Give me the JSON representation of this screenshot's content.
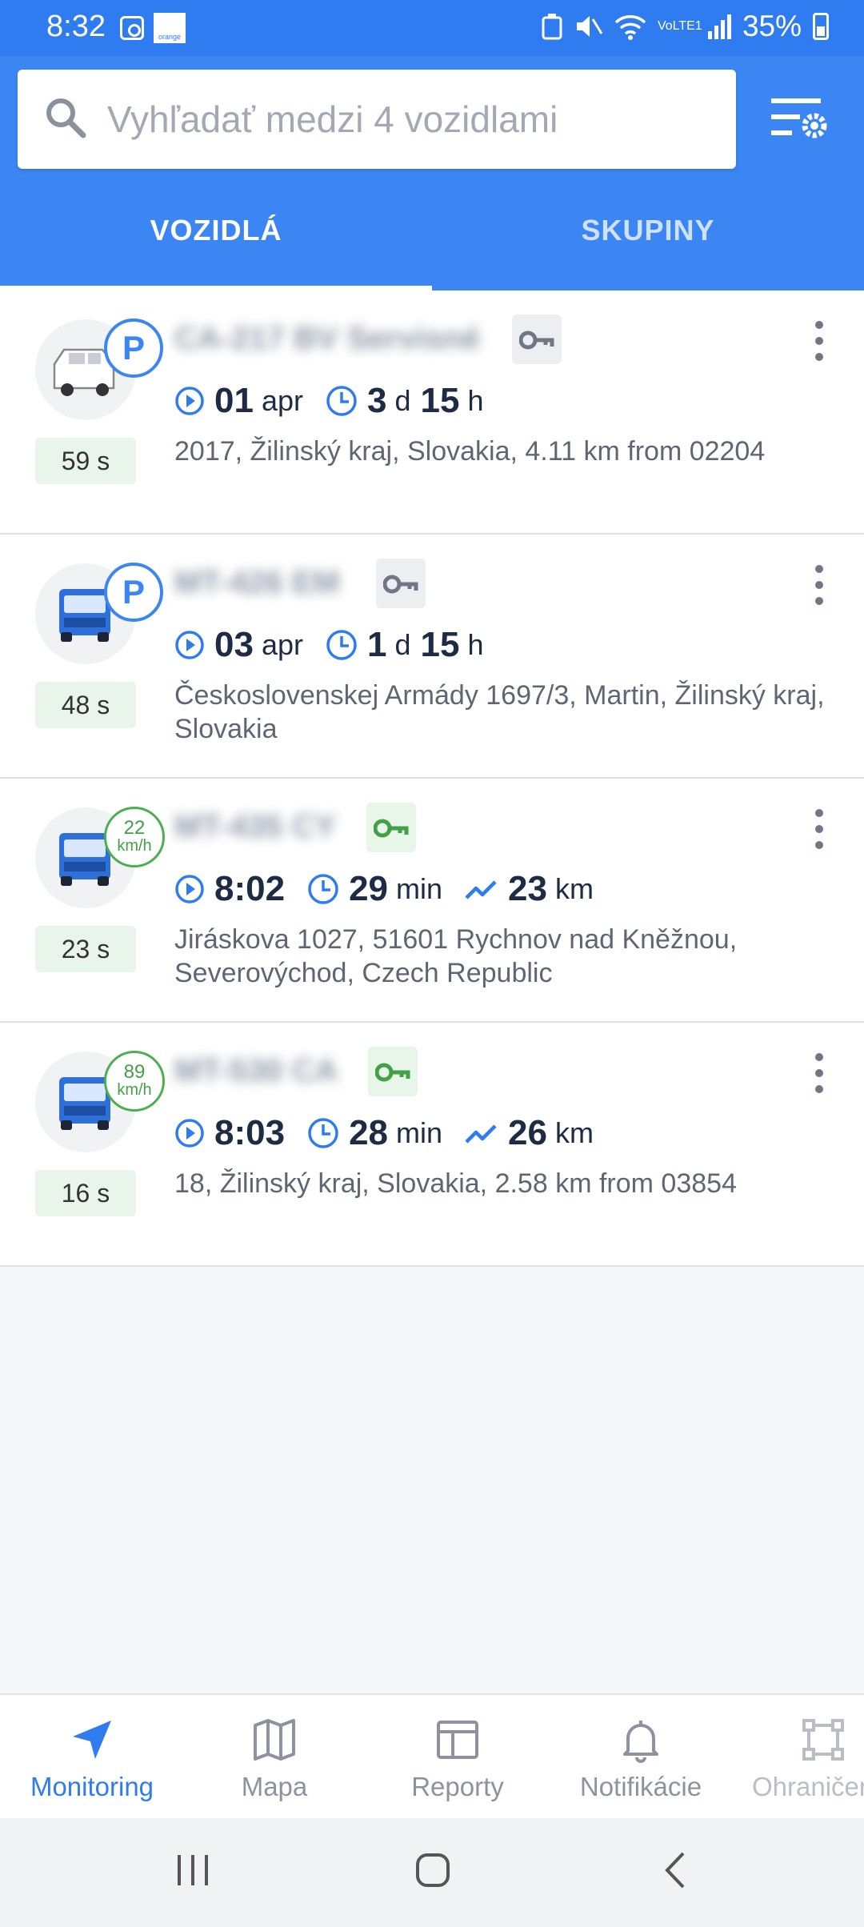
{
  "status_bar": {
    "time": "8:32",
    "carrier_logo": "orange",
    "network": "VoLTE1",
    "battery": "35%"
  },
  "search": {
    "placeholder": "Vyhľadať medzi 4 vozidlami",
    "value": ""
  },
  "tabs": [
    {
      "label": "VOZIDLÁ",
      "active": true
    },
    {
      "label": "SKUPINY",
      "active": false
    }
  ],
  "vehicles": [
    {
      "plate": "CA-217 BV Servisné",
      "icon": "van-icon",
      "state": "P",
      "last_update": "59 s",
      "ignition": "off",
      "start_value": "01",
      "start_unit": "apr",
      "duration_days": "3",
      "duration_days_unit": "d",
      "duration_hours": "15",
      "duration_hours_unit": "h",
      "address": "2017, Žilinský kraj, Slovakia, 4.11 km from 02204"
    },
    {
      "plate": "MT-426 EM",
      "icon": "truck-icon",
      "state": "P",
      "last_update": "48 s",
      "ignition": "off",
      "start_value": "03",
      "start_unit": "apr",
      "duration_days": "1",
      "duration_days_unit": "d",
      "duration_hours": "15",
      "duration_hours_unit": "h",
      "address": "Československej Armády 1697/3, Martin, Žilinský kraj, Slovakia"
    },
    {
      "plate": "MT-435 CY",
      "icon": "truck-icon",
      "speed": "22",
      "speed_unit": "km/h",
      "last_update": "23 s",
      "ignition": "on",
      "start_value": "8:02",
      "duration_value": "29",
      "duration_unit": "min",
      "distance_value": "23",
      "distance_unit": "km",
      "address": "Jiráskova 1027, 51601 Rychnov nad Kněžnou, Severovýchod, Czech Republic"
    },
    {
      "plate": "MT-530 CA",
      "icon": "truck-icon",
      "speed": "89",
      "speed_unit": "km/h",
      "last_update": "16 s",
      "ignition": "on",
      "start_value": "8:03",
      "duration_value": "28",
      "duration_unit": "min",
      "distance_value": "26",
      "distance_unit": "km",
      "address": "18, Žilinský kraj, Slovakia, 2.58 km from 03854"
    }
  ],
  "bottom_nav": [
    {
      "label": "Monitoring",
      "icon": "navigation-arrow-icon",
      "active": true
    },
    {
      "label": "Mapa",
      "icon": "map-icon",
      "active": false
    },
    {
      "label": "Reporty",
      "icon": "report-table-icon",
      "active": false
    },
    {
      "label": "Notifikácie",
      "icon": "bell-icon",
      "active": false
    },
    {
      "label": "Ohraničenia",
      "icon": "geofence-icon",
      "active": false
    }
  ],
  "colors": {
    "primary": "#3b86f3",
    "ignition_on": "#43a047",
    "ignition_off": "#6f7784",
    "age_badge_bg": "#e9f4ea"
  }
}
